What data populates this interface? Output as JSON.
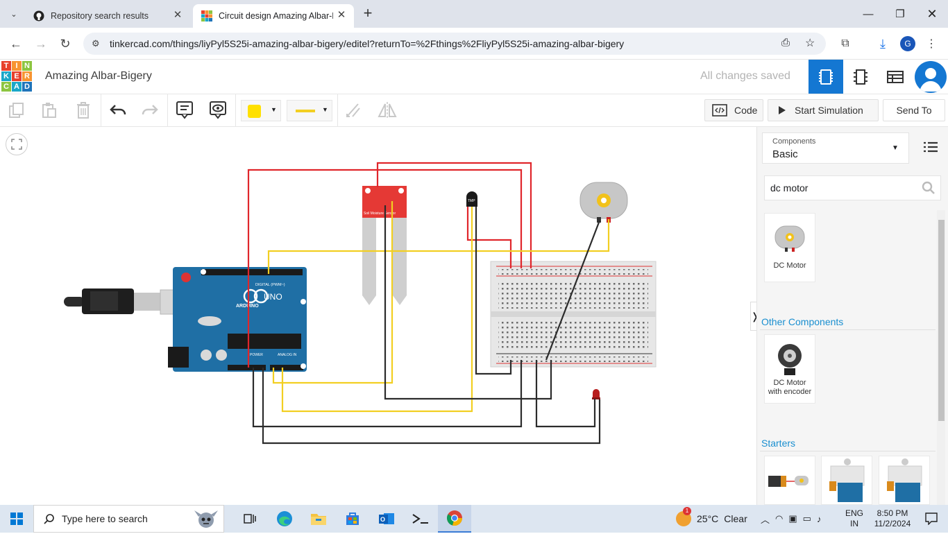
{
  "browser": {
    "tabs": [
      {
        "title": "Repository search results",
        "icon": "github-icon"
      },
      {
        "title": "Circuit design Amazing Albar-B",
        "icon": "tinkercad-icon"
      }
    ],
    "new_tab": "+",
    "url": "tinkercad.com/things/liyPyl5S25i-amazing-albar-bigery/editel?returnTo=%2Fthings%2FliyPyl5S25i-amazing-albar-bigery",
    "profile_initial": "G"
  },
  "app": {
    "logo_letters": [
      "T",
      "I",
      "N",
      "K",
      "E",
      "R",
      "C",
      "A",
      "D"
    ],
    "logo_colors": [
      "#e8412c",
      "#f79431",
      "#8cc540",
      "#19a7c9",
      "#e8412c",
      "#f79431",
      "#8cc540",
      "#19a7c9",
      "#1f74ba"
    ],
    "project_title": "Amazing Albar-Bigery",
    "save_status": "All changes saved",
    "toolbar": {
      "code_label": "Code",
      "start_sim_label": "Start Simulation",
      "send_to_label": "Send To"
    }
  },
  "panel": {
    "components_caption": "Components",
    "components_value": "Basic",
    "search_value": "dc motor",
    "results": [
      {
        "label": "DC Motor"
      }
    ],
    "other_title": "Other Components",
    "other": [
      {
        "label": "DC Motor with encoder"
      }
    ],
    "starters_title": "Starters",
    "collapse_glyph": "❭"
  },
  "circuit": {
    "board_label": "UNO",
    "board_brand": "ARDUINO",
    "digital_label": "DIGITAL (PWM~)",
    "power_label": "POWER",
    "analog_label": "ANALOG IN",
    "sensor_label": "Soil Moisture Sensor",
    "tmp_label": "TMP"
  },
  "taskbar": {
    "search_placeholder": "Type here to search",
    "weather_temp": "25°C",
    "weather_text": "Clear",
    "weather_badge": "1",
    "lang_top": "ENG",
    "lang_bottom": "IN",
    "time": "8:50 PM",
    "date": "11/2/2024"
  },
  "colors": {
    "accent": "#1477d2",
    "wire_red": "#e0262b",
    "wire_yellow": "#f2cf22",
    "wire_black": "#2b2b2b"
  }
}
